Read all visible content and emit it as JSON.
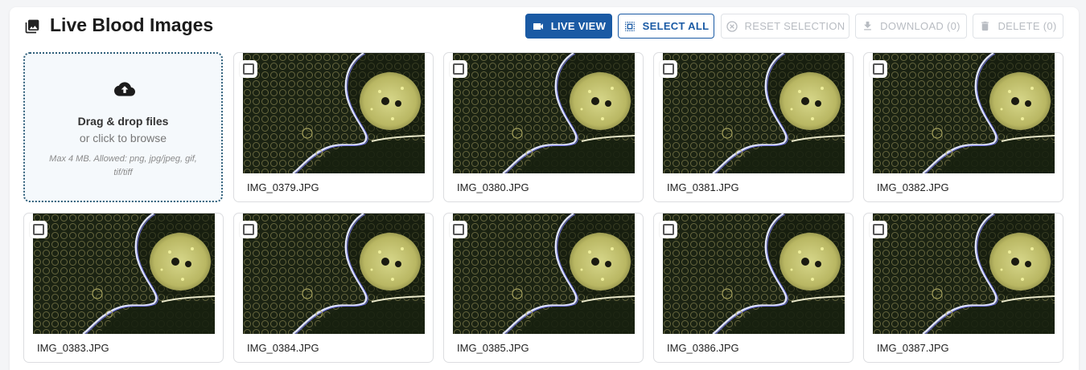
{
  "header": {
    "title": "Live Blood Images",
    "title_icon": "photo-library-icon"
  },
  "toolbar": {
    "live_view": {
      "label": "LIVE VIEW",
      "icon": "videocam-icon"
    },
    "select_all": {
      "label": "SELECT ALL",
      "icon": "select-all-icon"
    },
    "reset_selection": {
      "label": "RESET SELECTION",
      "icon": "cancel-icon",
      "disabled": true
    },
    "download": {
      "label": "DOWNLOAD (0)",
      "icon": "download-icon",
      "disabled": true
    },
    "delete": {
      "label": "DELETE (0)",
      "icon": "trash-icon",
      "disabled": true
    }
  },
  "dropzone": {
    "icon": "cloud-upload-icon",
    "title": "Drag & drop files",
    "subtitle": "or click to browse",
    "hint": "Max 4 MB. Allowed: png, jpg/jpeg, gif, tif/tiff"
  },
  "images": [
    {
      "filename": "IMG_0379.JPG",
      "selected": false
    },
    {
      "filename": "IMG_0380.JPG",
      "selected": false
    },
    {
      "filename": "IMG_0381.JPG",
      "selected": false
    },
    {
      "filename": "IMG_0382.JPG",
      "selected": false
    },
    {
      "filename": "IMG_0383.JPG",
      "selected": false
    },
    {
      "filename": "IMG_0384.JPG",
      "selected": false
    },
    {
      "filename": "IMG_0385.JPG",
      "selected": false
    },
    {
      "filename": "IMG_0386.JPG",
      "selected": false
    },
    {
      "filename": "IMG_0387.JPG",
      "selected": false
    }
  ],
  "colors": {
    "primary": "#1a5aa4",
    "disabled_text": "#b8bcc2",
    "dropzone_border": "#2f5f7a",
    "dropzone_bg": "#f5f9fc"
  }
}
